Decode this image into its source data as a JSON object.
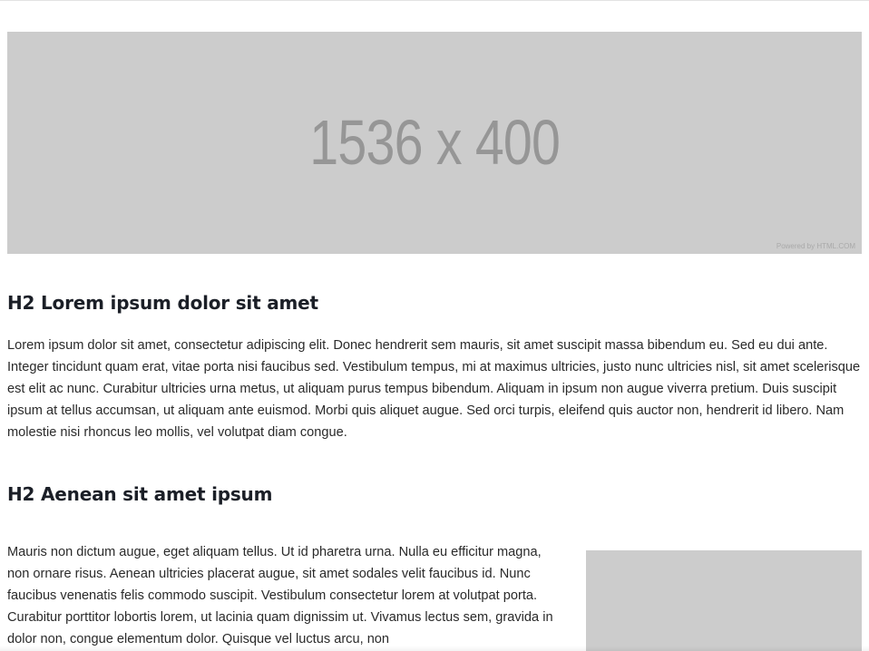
{
  "hero_image": {
    "dimensions_label": "1536 x 400",
    "credit": "Powered by HTML.COM"
  },
  "section_1": {
    "heading": "H2 Lorem ipsum dolor sit amet",
    "body": "Lorem ipsum dolor sit amet, consectetur adipiscing elit. Donec hendrerit sem mauris, sit amet suscipit massa bibendum eu. Sed eu dui ante. Integer tincidunt quam erat, vitae porta nisi faucibus sed. Vestibulum tempus, mi at maximus ultricies, justo nunc ultricies nisl, sit amet scelerisque est elit ac nunc. Curabitur ultricies urna metus, ut aliquam purus tempus bibendum. Aliquam in ipsum non augue viverra pretium. Duis suscipit ipsum at tellus accumsan, ut aliquam ante euismod. Morbi quis aliquet augue. Sed orci turpis, eleifend quis auctor non, hendrerit id libero. Nam molestie nisi rhoncus leo mollis, vel volutpat diam congue."
  },
  "section_2": {
    "heading": "H2 Aenean sit amet ipsum",
    "body": "Mauris non dictum augue, eget aliquam tellus. Ut id pharetra urna. Nulla eu efficitur magna, non ornare risus. Aenean ultricies placerat augue, sit amet sodales velit faucibus id. Nunc faucibus venenatis felis commodo suscipit. Vestibulum consectetur lorem at volutpat porta. Curabitur porttitor lobortis lorem, ut lacinia quam dignissim ut. Vivamus lectus sem, gravida in dolor non, congue elementum dolor. Quisque vel luctus arcu, non"
  }
}
